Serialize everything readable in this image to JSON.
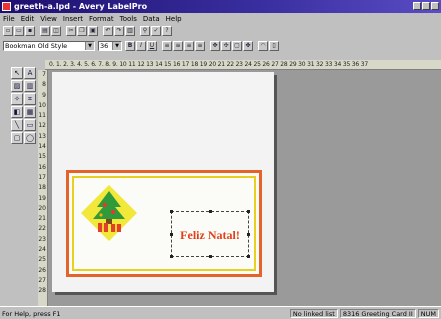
{
  "window": {
    "title": "greeth-a.lpd - Avery LabelPro"
  },
  "menu": [
    "File",
    "Edit",
    "View",
    "Insert",
    "Format",
    "Tools",
    "Data",
    "Help"
  ],
  "format_toolbar": {
    "font": "Bookman Old Style",
    "size": "36",
    "buttons": [
      "B",
      "I",
      "U"
    ]
  },
  "ruler": {
    "horizontal": "0. 1. 2. 3. 4. 5. 6. 7. 8. 9. 10 11 12 13 14 15 16 17 18 19 20 21 22 23 24 25 26 27 28 29 30 31 32 33 34 35 36 37",
    "vertical": [
      "7",
      "8",
      "9",
      "10",
      "11",
      "12",
      "13",
      "14",
      "15",
      "16",
      "17",
      "18",
      "19",
      "20",
      "21",
      "22",
      "23",
      "24",
      "25",
      "26",
      "27",
      "28"
    ]
  },
  "card": {
    "text": "Feliz Natal!"
  },
  "status": {
    "help": "For Help, press F1",
    "linked": "No linked list",
    "card": "8316 Greeting Card II",
    "num": "NUM"
  },
  "colors": {
    "border_orange": "#e3632a",
    "border_yellow": "#e8d020",
    "text_red": "#e04018",
    "titlebar": "#1d0f6e"
  }
}
